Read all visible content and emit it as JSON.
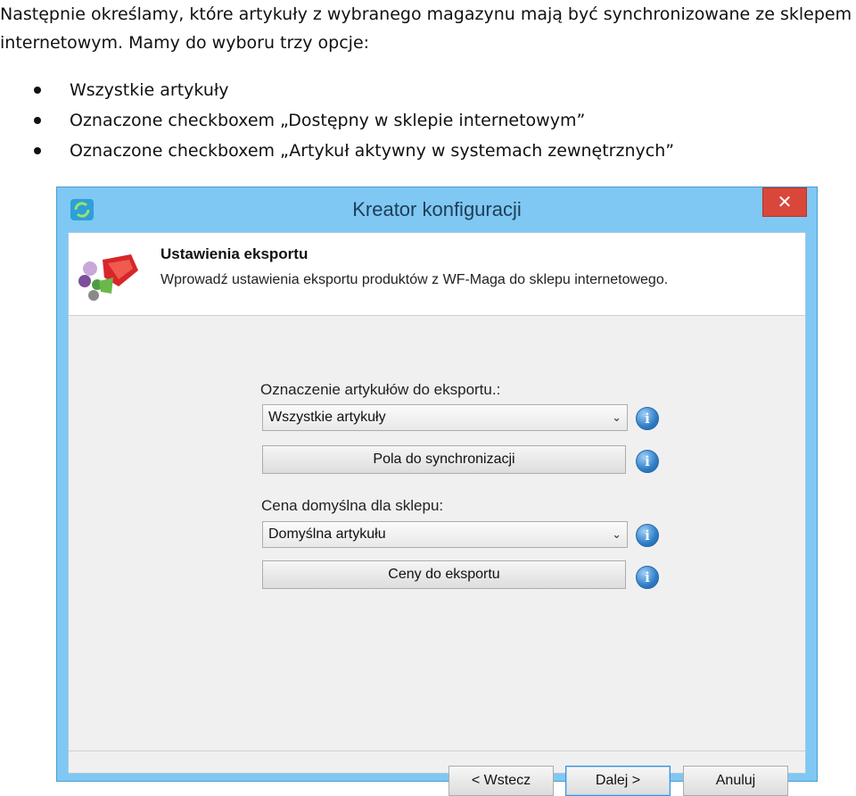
{
  "doc": {
    "paragraph": "Następnie określamy, które artykuły z wybranego magazynu mają być synchronizowane ze sklepem internetowym. Mamy do wyboru trzy opcje:",
    "options": [
      "Wszystkie artykuły",
      "Oznaczone checkboxem „Dostępny w sklepie internetowym”",
      "Oznaczone  checkboxem „Artykuł aktywny w systemach zewnętrznych”"
    ]
  },
  "window": {
    "title": "Kreator konfiguracji",
    "close_glyph": "✕",
    "header": {
      "title": "Ustawienia eksportu",
      "description": "Wprowadź ustawienia eksportu produktów z WF-Maga do sklepu internetowego."
    },
    "form": {
      "marking_label": "Oznaczenie artykułów do eksportu.:",
      "marking_value": "Wszystkie artykuły",
      "sync_fields_button": "Pola do synchronizacji",
      "price_label": "Cena domyślna dla sklepu:",
      "price_value": "Domyślna artykułu",
      "export_prices_button": "Ceny do eksportu",
      "info_glyph": "i",
      "chevron_glyph": "⌄"
    },
    "footer": {
      "back_button": "< Wstecz",
      "next_button": "Dalej >",
      "cancel_button": "Anuluj"
    }
  }
}
